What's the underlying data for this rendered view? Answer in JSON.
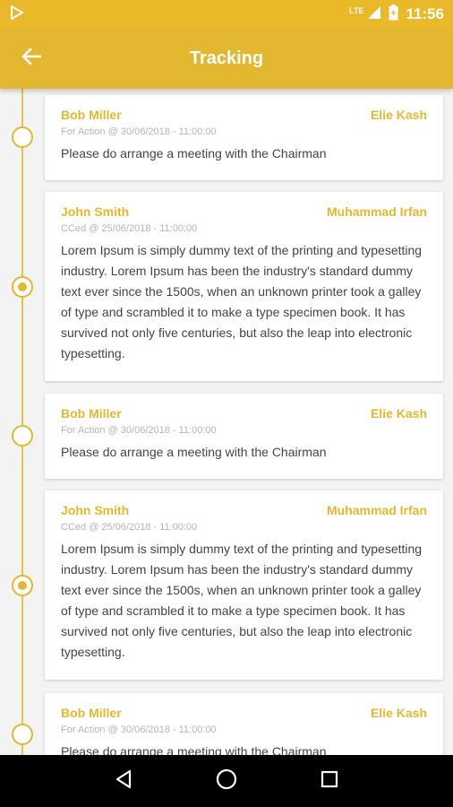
{
  "status_bar": {
    "left_icon": "play-store-icon",
    "network": "LTE",
    "time": "11:56"
  },
  "app_bar": {
    "title": "Tracking",
    "back_icon": "arrow-left-icon"
  },
  "colors": {
    "primary": "#e3b72f",
    "status_bar": "#e9b929",
    "text": "#444444",
    "meta": "#b5b5b5"
  },
  "entries": [
    {
      "sender": "Bob Miller",
      "recipient": "Elie Kash",
      "meta": "For Action @ 30/06/2018 - 11:00:00",
      "message": "Please do arrange a meeting with the Chairman",
      "node": "hollow"
    },
    {
      "sender": "John Smith",
      "recipient": "Muhammad Irfan",
      "meta": "CCed @ 25/06/2018 - 11:00:00",
      "message": "Lorem Ipsum is simply dummy text of the printing and typesetting industry. Lorem Ipsum has been the industry's standard dummy text ever since the 1500s, when an unknown printer took a galley of type and scrambled it to make a type specimen book. It has survived not only five centuries, but also the leap into electronic typesetting.",
      "node": "filled"
    },
    {
      "sender": "Bob Miller",
      "recipient": "Elie Kash",
      "meta": "For Action @ 30/06/2018 - 11:00:00",
      "message": "Please do arrange a meeting with the Chairman",
      "node": "hollow"
    },
    {
      "sender": "John Smith",
      "recipient": "Muhammad Irfan",
      "meta": "CCed @ 25/06/2018 - 11:00:00",
      "message": "Lorem Ipsum is simply dummy text of the printing and typesetting industry. Lorem Ipsum has been the industry's standard dummy text ever since the 1500s, when an unknown printer took a galley of type and scrambled it to make a type specimen book. It has survived not only five centuries, but also the leap into electronic typesetting.",
      "node": "filled"
    },
    {
      "sender": "Bob Miller",
      "recipient": "Elie Kash",
      "meta": "For Action @ 30/06/2018 - 11:00:00",
      "message": "Please do arrange a meeting with the Chairman",
      "node": "hollow"
    }
  ],
  "nav_bar": {
    "back": "nav-back-icon",
    "home": "nav-home-icon",
    "recents": "nav-recents-icon"
  }
}
